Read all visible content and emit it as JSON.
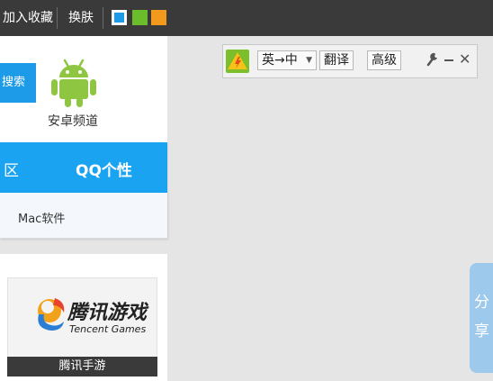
{
  "topbar": {
    "add_favorite": "加入收藏",
    "change_skin": "换肤",
    "skin_colors": [
      "#1e9be8",
      "#6cbd2b",
      "#f39a1d"
    ]
  },
  "sidebar": {
    "search_label": "搜索",
    "android_label": "安卓频道",
    "band_left": "区",
    "band_right": "QQ个性",
    "mac_link": "Mac软件"
  },
  "game_card": {
    "logo_title": "腾讯游戏",
    "logo_sub": "Tencent Games",
    "caption": "腾讯手游"
  },
  "translate_bar": {
    "mode": "英→中",
    "translate_button": "翻译",
    "advanced_button": "高级",
    "tool_icon": "wrench-icon",
    "minimize_icon": "minus-icon",
    "close_icon": "close-icon"
  },
  "share_tab": {
    "char1": "分",
    "char2": "享"
  },
  "colors": {
    "topbar_bg": "#3a3a3a",
    "accent_blue": "#1aa3f0",
    "android_green": "#8fc641",
    "share_bg": "#9cc9ec"
  }
}
